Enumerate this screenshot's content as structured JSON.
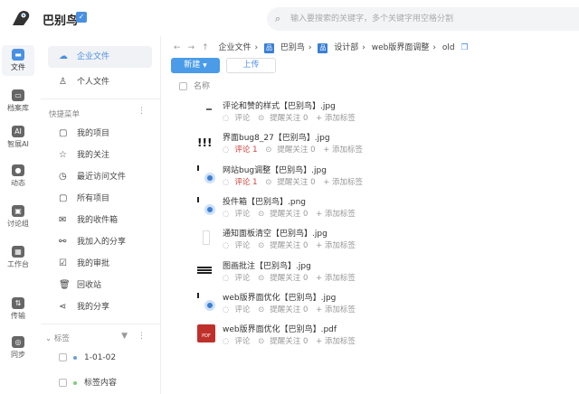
{
  "header": {
    "brand": "巴别鸟",
    "search_placeholder": "输入要搜索的关键字，多个关键字用空格分割"
  },
  "rail": [
    {
      "label": "文件",
      "glyph": "▬"
    },
    {
      "label": "档案库",
      "glyph": "▭"
    },
    {
      "label": "智展AI",
      "glyph": "AI"
    },
    {
      "label": "动态",
      "glyph": "●"
    },
    {
      "label": "讨论组",
      "glyph": "▣"
    },
    {
      "label": "工作台",
      "glyph": "▦"
    },
    {
      "label": "传输",
      "glyph": "⇅"
    },
    {
      "label": "同步",
      "glyph": "◎"
    }
  ],
  "sidebar": {
    "top": [
      {
        "label": "企业文件",
        "icon": "☁"
      },
      {
        "label": "个人文件",
        "icon": "♙"
      }
    ],
    "quick_title": "快捷菜单",
    "quick": [
      {
        "label": "我的项目",
        "icon": "▢"
      },
      {
        "label": "我的关注",
        "icon": "☆"
      },
      {
        "label": "最近访问文件",
        "icon": "◷"
      },
      {
        "label": "所有项目",
        "icon": "▢"
      },
      {
        "label": "我的收件箱",
        "icon": "✉"
      },
      {
        "label": "我加入的分享",
        "icon": "⚯"
      },
      {
        "label": "我的审批",
        "icon": "☑"
      },
      {
        "label": "回收站",
        "icon": "🗑"
      },
      {
        "label": "我的分享",
        "icon": "⋖"
      }
    ],
    "tags_title": "标签",
    "tags": [
      {
        "label": "1-01-02",
        "color": "#6aa0d8"
      },
      {
        "label": "标签内容",
        "color": "#7ccf7c"
      }
    ]
  },
  "breadcrumb": [
    "企业文件",
    "巴别鸟",
    "设计部",
    "web版界面调整",
    "old"
  ],
  "toolbar": {
    "new_label": "新建",
    "upload_label": "上传"
  },
  "list": {
    "header": "名称",
    "comment_label": "评论",
    "remind_label": "提醒关注 0",
    "addtag_label": "+ 添加标签",
    "files": [
      {
        "name": "评论和赞的样式【巴别鸟】.jpg",
        "comment": "评论",
        "hot": false,
        "thumb": "dash"
      },
      {
        "name": "界面bug8_27【巴别鸟】.jpg",
        "comment": "评论 1",
        "hot": true,
        "thumb": "bang"
      },
      {
        "name": "网站bug调整【巴别鸟】.jpg",
        "comment": "评论 1",
        "hot": true,
        "thumb": "circle"
      },
      {
        "name": "投件箱【巴别鸟】.png",
        "comment": "评论",
        "hot": false,
        "thumb": "circle"
      },
      {
        "name": "通知面板清空【巴别鸟】.jpg",
        "comment": "评论",
        "hot": false,
        "thumb": "doc"
      },
      {
        "name": "图画批注【巴别鸟】.jpg",
        "comment": "评论",
        "hot": false,
        "thumb": "bars"
      },
      {
        "name": "web版界面优化【巴别鸟】.jpg",
        "comment": "评论",
        "hot": false,
        "thumb": "circle"
      },
      {
        "name": "web版界面优化【巴别鸟】.pdf",
        "comment": "评论",
        "hot": false,
        "thumb": "pdf"
      }
    ]
  }
}
